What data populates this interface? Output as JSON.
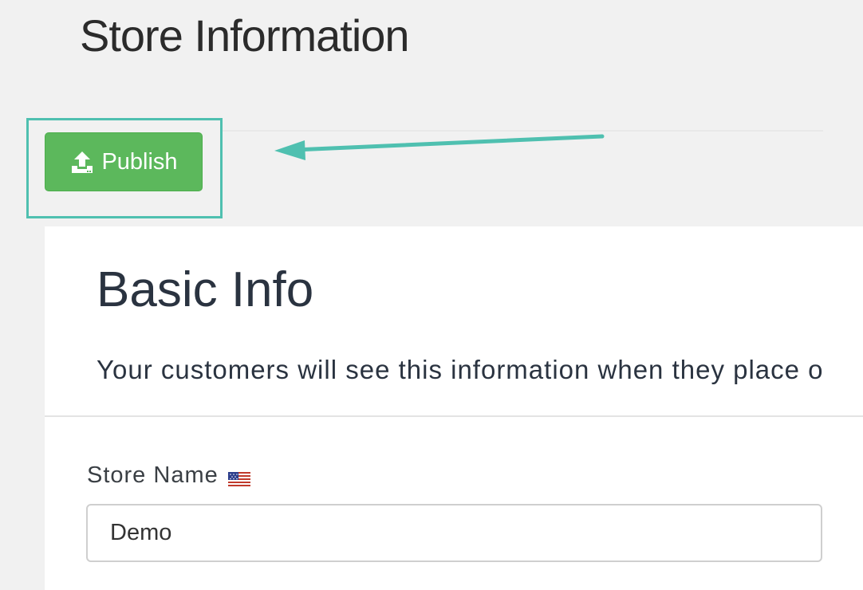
{
  "header": {
    "title": "Store Information"
  },
  "toolbar": {
    "publish_label": "Publish",
    "publish_icon": "upload-icon",
    "accent_color": "#5cb85c",
    "highlight_color": "#4fc0b0"
  },
  "basic_info": {
    "heading": "Basic Info",
    "description": "Your customers will see this information when they place o"
  },
  "store_name_field": {
    "label": "Store Name",
    "flag_icon": "us-flag-icon",
    "value": "Demo"
  }
}
